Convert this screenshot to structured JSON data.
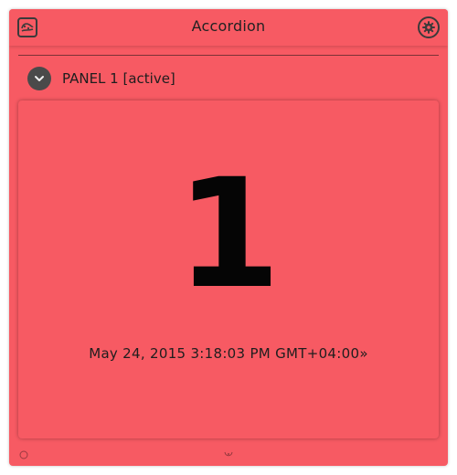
{
  "window": {
    "title": "Accordion",
    "app_icon": "app-logo-icon",
    "settings_icon": "gear-icon"
  },
  "panel": {
    "toggle_icon": "chevron-down-icon",
    "label": "PANEL 1 [active]",
    "big_value": "1",
    "timestamp": "May 24, 2015 3:18:03 PM GMT+04:00»"
  },
  "footer": {
    "left_icon": "circle-icon",
    "center_icon": "grab-handle-icon"
  },
  "colors": {
    "background": "#f75a63",
    "text": "#1e1e1e",
    "icon_dark": "#3a3a3a"
  }
}
